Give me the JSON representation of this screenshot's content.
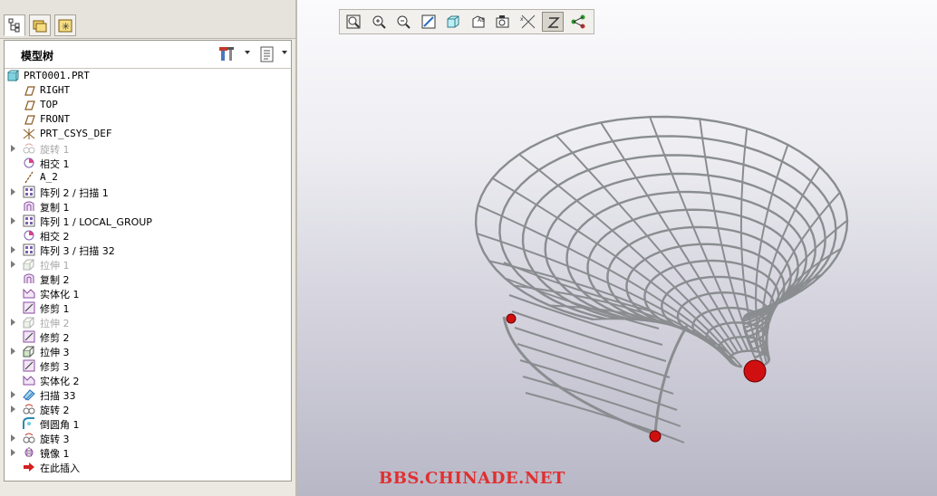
{
  "tree": {
    "title": "模型树",
    "items": [
      {
        "label": "PRT0001.PRT",
        "icon": "part-icon",
        "indent": 0,
        "expand": false,
        "disabled": false,
        "mono": true
      },
      {
        "label": "RIGHT",
        "icon": "datum-plane-icon",
        "indent": 1,
        "expand": false,
        "disabled": false,
        "mono": true
      },
      {
        "label": "TOP",
        "icon": "datum-plane-icon",
        "indent": 1,
        "expand": false,
        "disabled": false,
        "mono": true
      },
      {
        "label": "FRONT",
        "icon": "datum-plane-icon",
        "indent": 1,
        "expand": false,
        "disabled": false,
        "mono": true
      },
      {
        "label": "PRT_CSYS_DEF",
        "icon": "csys-icon",
        "indent": 1,
        "expand": false,
        "disabled": false,
        "mono": true
      },
      {
        "label": "旋转 1",
        "icon": "revolve-icon",
        "indent": 1,
        "expand": true,
        "disabled": true,
        "mono": false
      },
      {
        "label": "相交 1",
        "icon": "intersect-icon",
        "indent": 1,
        "expand": false,
        "disabled": false,
        "mono": false
      },
      {
        "label": "A_2",
        "icon": "datum-axis-icon",
        "indent": 1,
        "expand": false,
        "disabled": false,
        "mono": true
      },
      {
        "label": "阵列 2 / 扫描 1",
        "icon": "pattern-icon",
        "indent": 1,
        "expand": true,
        "disabled": false,
        "mono": false
      },
      {
        "label": "复制 1",
        "icon": "copy-icon",
        "indent": 1,
        "expand": false,
        "disabled": false,
        "mono": false
      },
      {
        "label": "阵列 1 / LOCAL_GROUP",
        "icon": "pattern-icon",
        "indent": 1,
        "expand": true,
        "disabled": false,
        "mono": false
      },
      {
        "label": "相交 2",
        "icon": "intersect-icon",
        "indent": 1,
        "expand": false,
        "disabled": false,
        "mono": false
      },
      {
        "label": "阵列 3 / 扫描 32",
        "icon": "pattern-icon",
        "indent": 1,
        "expand": true,
        "disabled": false,
        "mono": false
      },
      {
        "label": "拉伸 1",
        "icon": "extrude-icon",
        "indent": 1,
        "expand": true,
        "disabled": true,
        "mono": false
      },
      {
        "label": "复制 2",
        "icon": "copy-icon",
        "indent": 1,
        "expand": false,
        "disabled": false,
        "mono": false
      },
      {
        "label": "实体化 1",
        "icon": "solidify-icon",
        "indent": 1,
        "expand": false,
        "disabled": false,
        "mono": false
      },
      {
        "label": "修剪 1",
        "icon": "trim-icon",
        "indent": 1,
        "expand": false,
        "disabled": false,
        "mono": false
      },
      {
        "label": "拉伸 2",
        "icon": "extrude-icon",
        "indent": 1,
        "expand": true,
        "disabled": true,
        "mono": false
      },
      {
        "label": "修剪 2",
        "icon": "trim-icon",
        "indent": 1,
        "expand": false,
        "disabled": false,
        "mono": false
      },
      {
        "label": "拉伸 3",
        "icon": "extrude-icon",
        "indent": 1,
        "expand": true,
        "disabled": false,
        "mono": false
      },
      {
        "label": "修剪 3",
        "icon": "trim-icon",
        "indent": 1,
        "expand": false,
        "disabled": false,
        "mono": false
      },
      {
        "label": "实体化 2",
        "icon": "solidify-icon",
        "indent": 1,
        "expand": false,
        "disabled": false,
        "mono": false
      },
      {
        "label": "扫描 33",
        "icon": "sweep-icon",
        "indent": 1,
        "expand": true,
        "disabled": false,
        "mono": false
      },
      {
        "label": "旋转 2",
        "icon": "revolve-icon",
        "indent": 1,
        "expand": true,
        "disabled": false,
        "mono": false
      },
      {
        "label": "倒圆角 1",
        "icon": "round-icon",
        "indent": 1,
        "expand": false,
        "disabled": false,
        "mono": false
      },
      {
        "label": "旋转 3",
        "icon": "revolve-icon",
        "indent": 1,
        "expand": true,
        "disabled": false,
        "mono": false
      },
      {
        "label": "镜像 1",
        "icon": "mirror-icon",
        "indent": 1,
        "expand": true,
        "disabled": false,
        "mono": false
      },
      {
        "label": "在此插入",
        "icon": "insert-here-icon",
        "indent": 1,
        "expand": false,
        "disabled": false,
        "mono": false
      }
    ]
  },
  "toolbar": {
    "buttons": [
      {
        "name": "refit-icon"
      },
      {
        "name": "zoom-in-icon"
      },
      {
        "name": "zoom-out-icon"
      },
      {
        "name": "repaint-icon"
      },
      {
        "name": "shading-icon"
      },
      {
        "name": "saved-views-icon"
      },
      {
        "name": "layers-icon"
      },
      {
        "name": "datum-display-icon"
      },
      {
        "name": "spin-center-icon"
      },
      {
        "name": "annotation-display-icon"
      }
    ]
  },
  "watermark": "BBS.CHINADE.NET",
  "colors": {
    "wire": "#8a8d90",
    "ball": "#d01010",
    "accent": "#2a6ebb"
  }
}
